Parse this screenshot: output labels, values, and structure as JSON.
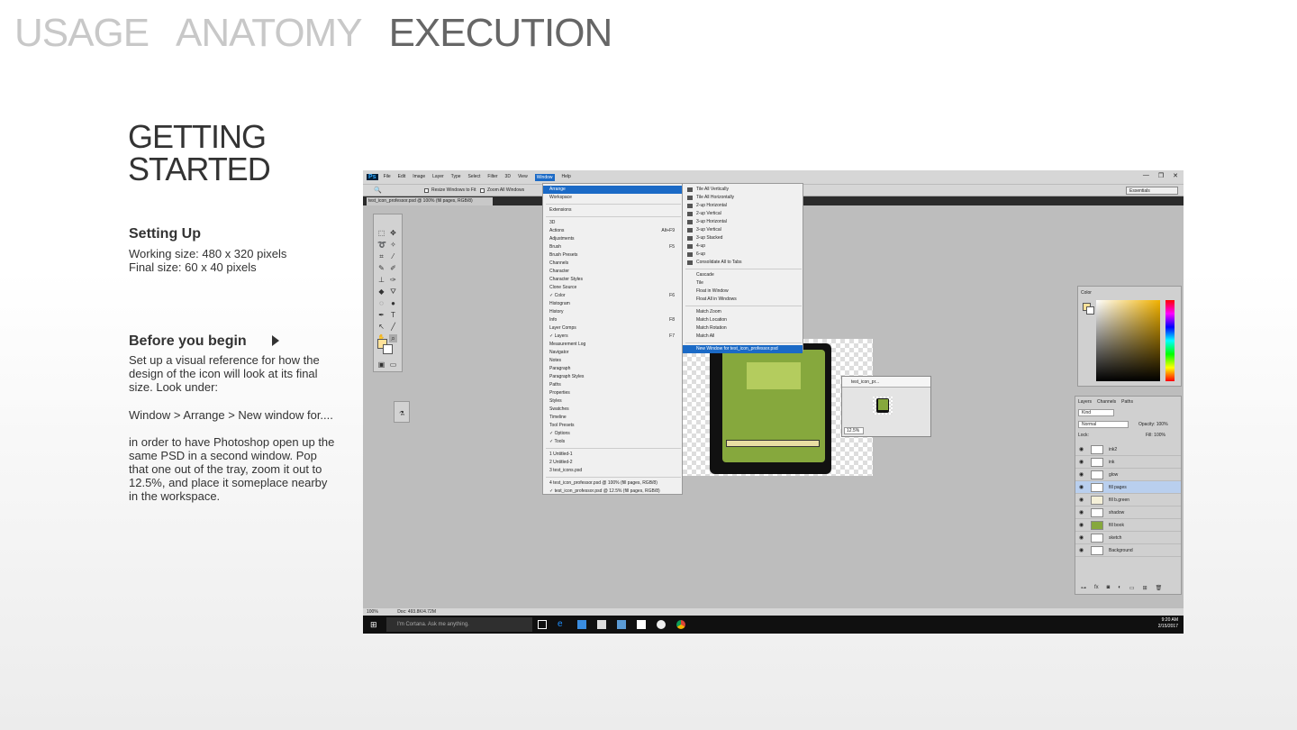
{
  "nav": {
    "usage": "USAGE",
    "anatomy": "ANATOMY",
    "execution": "EXECUTION"
  },
  "section": {
    "title_line1": "GETTING",
    "title_line2": "STARTED"
  },
  "setting_up": {
    "heading": "Setting Up",
    "line1": "Working size: 480 x 320 pixels",
    "line2": "Final size: 60 x 40 pixels"
  },
  "before": {
    "heading": "Before you begin",
    "p1": "Set up a visual reference for how the design of the icon will look at its final size. Look under:",
    "p2": "Window > Arrange > New window for....",
    "p3": "in order to have Photoshop open up the same PSD in a second window. Pop that one out of the tray, zoom it out to 12.5%, and place it someplace nearby in the workspace."
  },
  "ps": {
    "logo": "Ps",
    "menus": [
      "File",
      "Edit",
      "Image",
      "Layer",
      "Type",
      "Select",
      "Filter",
      "3D",
      "View",
      "Window",
      "Help"
    ],
    "active_menu": "Window",
    "opt_resize": "Resize Windows to Fit",
    "opt_zoom_all": "Zoom All Windows",
    "essentials": "Essentials",
    "doc_tab": "test_icon_professor.psd @ 100% (fill pages, RGB/8)",
    "status_zoom": "100%",
    "status_doc": "Doc: 493.8K/4.72M",
    "small_window_title": "test_icon_pr...",
    "small_window_zoom": "12.5%",
    "window_menu": [
      {
        "label": "Arrange",
        "sc": "",
        "hl": true
      },
      {
        "label": "Workspace",
        "sc": ""
      },
      {
        "label": "Extensions",
        "sc": ""
      },
      {
        "label": "3D",
        "sc": ""
      },
      {
        "label": "Actions",
        "sc": "Alt+F9"
      },
      {
        "label": "Adjustments",
        "sc": ""
      },
      {
        "label": "Brush",
        "sc": "F5"
      },
      {
        "label": "Brush Presets",
        "sc": ""
      },
      {
        "label": "Channels",
        "sc": ""
      },
      {
        "label": "Character",
        "sc": ""
      },
      {
        "label": "Character Styles",
        "sc": ""
      },
      {
        "label": "Clone Source",
        "sc": ""
      },
      {
        "label": "✓ Color",
        "sc": "F6"
      },
      {
        "label": "Histogram",
        "sc": ""
      },
      {
        "label": "History",
        "sc": ""
      },
      {
        "label": "Info",
        "sc": "F8"
      },
      {
        "label": "Layer Comps",
        "sc": ""
      },
      {
        "label": "✓ Layers",
        "sc": "F7"
      },
      {
        "label": "Measurement Log",
        "sc": ""
      },
      {
        "label": "Navigator",
        "sc": ""
      },
      {
        "label": "Notes",
        "sc": ""
      },
      {
        "label": "Paragraph",
        "sc": ""
      },
      {
        "label": "Paragraph Styles",
        "sc": ""
      },
      {
        "label": "Paths",
        "sc": ""
      },
      {
        "label": "Properties",
        "sc": ""
      },
      {
        "label": "Styles",
        "sc": ""
      },
      {
        "label": "Swatches",
        "sc": ""
      },
      {
        "label": "Timeline",
        "sc": ""
      },
      {
        "label": "Tool Presets",
        "sc": ""
      },
      {
        "label": "✓ Options",
        "sc": ""
      },
      {
        "label": "✓ Tools",
        "sc": ""
      },
      {
        "label": "1 Untitled-1",
        "sc": ""
      },
      {
        "label": "2 Untitled-2",
        "sc": ""
      },
      {
        "label": "3 test_icons.psd",
        "sc": ""
      },
      {
        "label": "4 test_icon_professor.psd @ 100% (fill pages, RGB/8)",
        "sc": ""
      },
      {
        "label": "✓ test_icon_professor.psd @ 12.5% (fill pages, RGB/8)",
        "sc": ""
      }
    ],
    "arrange_menu": [
      {
        "label": "Tile All Vertically"
      },
      {
        "label": "Tile All Horizontally"
      },
      {
        "label": "2-up Horizontal"
      },
      {
        "label": "2-up Vertical"
      },
      {
        "label": "3-up Horizontal"
      },
      {
        "label": "3-up Vertical"
      },
      {
        "label": "3-up Stacked"
      },
      {
        "label": "4-up"
      },
      {
        "label": "6-up"
      },
      {
        "label": "Consolidate All to Tabs"
      },
      {
        "label": "Cascade"
      },
      {
        "label": "Tile"
      },
      {
        "label": "Float in Window"
      },
      {
        "label": "Float All in Windows"
      },
      {
        "label": "Match Zoom"
      },
      {
        "label": "Match Location"
      },
      {
        "label": "Match Rotation"
      },
      {
        "label": "Match All"
      },
      {
        "label": "New Window for test_icon_professor.psd",
        "hl": true
      }
    ],
    "color_tab": "Color",
    "layer_tabs": [
      "Layers",
      "Channels",
      "Paths"
    ],
    "kind": "Kind",
    "blend": "Normal",
    "opacity": "Opacity: 100%",
    "lock": "Lock:",
    "fill": "Fill: 100%",
    "layers": [
      {
        "name": "ink2"
      },
      {
        "name": "ink"
      },
      {
        "name": "glow"
      },
      {
        "name": "fill pages",
        "sel": true
      },
      {
        "name": "fill b.green"
      },
      {
        "name": "shadow"
      },
      {
        "name": "fill book"
      },
      {
        "name": "sketch"
      },
      {
        "name": "Background"
      }
    ],
    "taskbar": {
      "search": "I'm Cortana. Ask me anything.",
      "time": "9:20 AM",
      "date": "2/15/2017"
    }
  }
}
